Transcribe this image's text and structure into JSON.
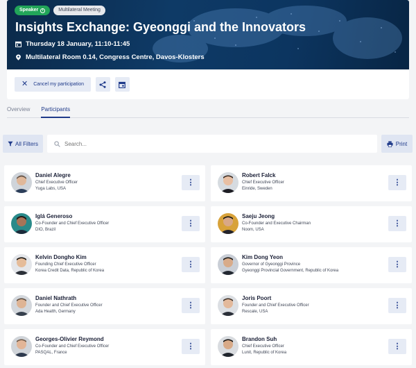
{
  "session": {
    "badges": {
      "speaker": "Speaker",
      "type": "Multilateral Meeting"
    },
    "title": "Insights Exchange: Gyeonggi and the Innovators",
    "date": "Thursday 18 January, 11:10-11:45",
    "location": "Multilateral Room 0.14, Congress Centre, Davos-Klosters",
    "actions": {
      "cancel_label": "Cancel my participation"
    }
  },
  "tabs": [
    {
      "label": "Overview",
      "active": false
    },
    {
      "label": "Participants",
      "active": true
    }
  ],
  "toolbar": {
    "filters_label": "All Filters",
    "search_placeholder": "Search...",
    "print_label": "Print"
  },
  "participants": [
    {
      "name": "Daniel Alegre",
      "role": "Chief Executive Officer",
      "org": "Yuga Labs, USA"
    },
    {
      "name": "Robert Falck",
      "role": "Chief Executive Officer",
      "org": "Einride, Sweden"
    },
    {
      "name": "Iglá Generoso",
      "role": "Co-Founder and Chief Executive Officer",
      "org": "DIO, Brazil"
    },
    {
      "name": "Saeju Jeong",
      "role": "Co-Founder and Executive Chairman",
      "org": "Noom, USA"
    },
    {
      "name": "Kelvin Dongho Kim",
      "role": "Founding Chief Executive Officer",
      "org": "Korea Credit Data, Republic of Korea"
    },
    {
      "name": "Kim Dong Yeon",
      "role": "Governor of Gyeonggi Province",
      "org": "Gyeonggi Provincial Government, Republic of Korea"
    },
    {
      "name": "Daniel Nathrath",
      "role": "Founder and Chief Executive Officer",
      "org": "Ada Health, Germany"
    },
    {
      "name": "Joris Poort",
      "role": "Founder and Chief Executive Officer",
      "org": "Rescale, USA"
    },
    {
      "name": "Georges-Olivier Reymond",
      "role": "Co-Founder and Chief Executive Officer",
      "org": "PASQAL, France"
    },
    {
      "name": "Brandon Suh",
      "role": "Chief Executive Officer",
      "org": "Lunit, Republic of Korea"
    }
  ],
  "colors": {
    "hero_bg": "#0e3a66",
    "accent": "#1f3a8a",
    "speaker_badge": "#22a559",
    "button_bg": "#e6ebf5"
  }
}
